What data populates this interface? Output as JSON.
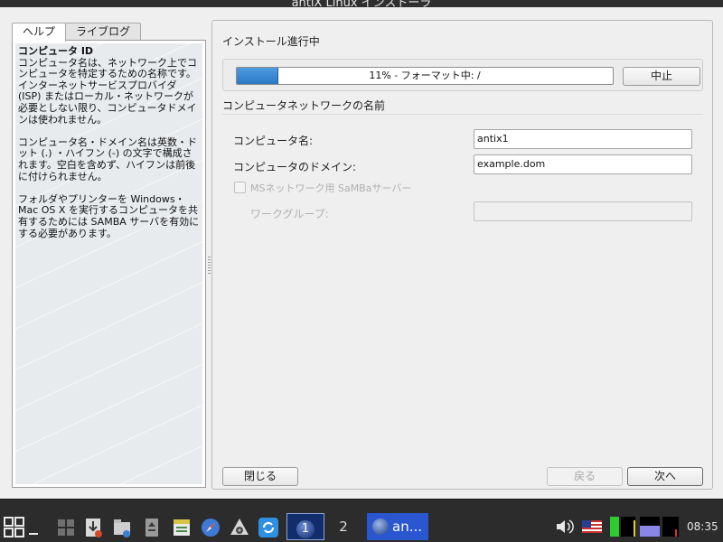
{
  "window": {
    "title": "antiX Linux インストーラ",
    "controls": [
      "−",
      "□",
      "×"
    ]
  },
  "left_pane": {
    "tabs": [
      {
        "label": "ヘルプ",
        "active": true
      },
      {
        "label": "ライブログ",
        "active": false
      }
    ],
    "help": {
      "heading": "コンピュータ ID",
      "paragraphs": [
        "コンピュータ名は、ネットワーク上でコンピュータを特定するための名称です。インターネットサービスプロバイダ (ISP) またはローカル・ネットワークが必要としない限り、コンピュータドメインは使われません。",
        "コンピュータ名・ドメイン名は英数・ドット (.) ・ハイフン (-) の文字で構成されます。空白を含めず、ハイフンは前後に付けられません。",
        "フォルダやプリンターを Windows・Mac OS X を実行するコンピュータを共有するためには SAMBA サーバを有効にする必要があります。"
      ]
    }
  },
  "progress_section": {
    "title": "インストール進行中",
    "progress_percent": 11,
    "progress_text": "11% - フォーマット中: /",
    "abort_label": "中止"
  },
  "network_section": {
    "title": "コンピュータネットワークの名前",
    "computer_name_label": "コンピュータ名:",
    "computer_name_value": "antix1",
    "domain_label": "コンピュータのドメイン:",
    "domain_value": "example.dom",
    "samba_label": "MSネットワーク用 SaMBaサーバー",
    "samba_checked": false,
    "workgroup_label": "ワークグループ:",
    "workgroup_value": ""
  },
  "footer": {
    "close_label": "閉じる",
    "back_label": "戻る",
    "next_label": "次へ"
  },
  "taskbar": {
    "workspace_1": "1",
    "workspace_2": "2",
    "task_label": "an...",
    "clock": "08:35"
  }
}
